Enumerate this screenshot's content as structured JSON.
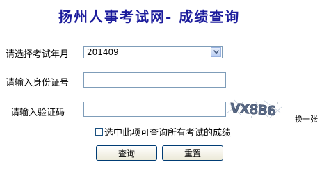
{
  "page": {
    "title": "扬州人事考试网- 成绩查询"
  },
  "form": {
    "exam_month": {
      "label": "请选择考试年月",
      "value": "201409"
    },
    "id_number": {
      "label": "请输入身份证号",
      "value": ""
    },
    "captcha": {
      "label": "请输入验证码",
      "value": "",
      "image_text": "VX8B6",
      "refresh_label": "换一张"
    },
    "all_exams_checkbox": {
      "label": "选中此项可查询所有考试的成绩",
      "checked": false
    }
  },
  "buttons": {
    "query_label": "查询",
    "reset_label": "重置"
  },
  "colors": {
    "title": "#1c1c9c",
    "input_border": "#7f9db9",
    "button_border": "#003c74"
  }
}
